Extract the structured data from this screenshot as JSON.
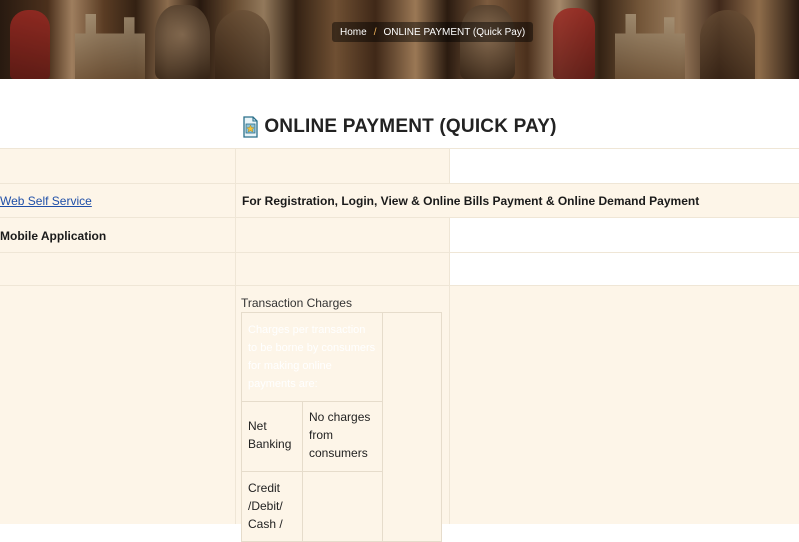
{
  "breadcrumb": {
    "home": "Home",
    "separator": "/",
    "current": "ONLINE PAYMENT (Quick Pay)"
  },
  "page": {
    "title": "ONLINE PAYMENT (QUICK PAY)",
    "title_icon": "document-star-icon"
  },
  "rows": [
    {
      "col1": "",
      "col2": ""
    },
    {
      "col1": "Web Self Service",
      "col2": "For Registration, Login, View & Online  Bills Payment & Online Demand Payment"
    },
    {
      "col1": "Mobile Application",
      "col2": ""
    },
    {
      "col1": "",
      "col2": ""
    }
  ],
  "charges": {
    "label": "Transaction Charges",
    "note": "Charges per transaction to be borne by consumers for making online payments are:",
    "items": [
      {
        "mode": "Net Banking",
        "charge": "No charges from consumers"
      },
      {
        "mode": "Credit /Debit/ Cash /",
        "charge": ""
      }
    ]
  },
  "colors": {
    "row_bg": "#fdf5e8",
    "link": "#1f4fa8",
    "breadcrumb_sep": "#f2b45a"
  }
}
